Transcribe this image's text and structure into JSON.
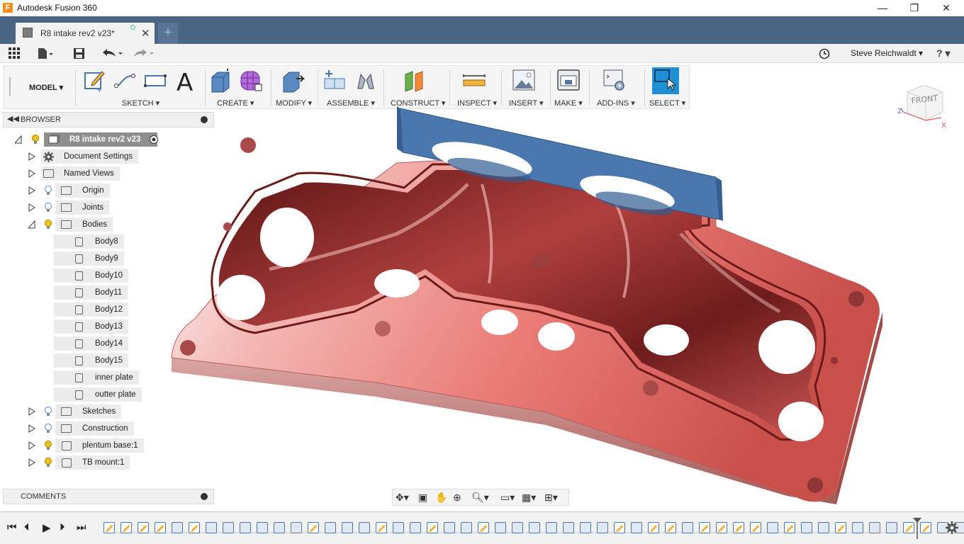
{
  "app": {
    "title": "Autodesk Fusion 360",
    "icon_letter": "F"
  },
  "window_controls": {
    "minimize": "—",
    "maximize": "❐",
    "close": "✕"
  },
  "tab": {
    "label": "R8 intake rev2 v23*",
    "close": "✕",
    "new_tab": "+"
  },
  "user": {
    "name": "Steve Reichwaldt ▾",
    "help": "? ▾"
  },
  "toolbar": {
    "workspace": "MODEL ▾",
    "groups": [
      {
        "label": "SKETCH ▾"
      },
      {
        "label": "CREATE ▾"
      },
      {
        "label": "MODIFY ▾"
      },
      {
        "label": "ASSEMBLE ▾"
      },
      {
        "label": "CONSTRUCT ▾"
      },
      {
        "label": "INSPECT ▾"
      },
      {
        "label": "INSERT ▾"
      },
      {
        "label": "MAKE ▾"
      },
      {
        "label": "ADD-INS ▾"
      },
      {
        "label": "SELECT ▾"
      }
    ],
    "sketch_text_icon": "A"
  },
  "browser": {
    "title": "BROWSER",
    "root": "R8 intake rev2 v23",
    "items": [
      {
        "label": "Document Settings"
      },
      {
        "label": "Named Views"
      },
      {
        "label": "Origin"
      },
      {
        "label": "Joints"
      },
      {
        "label": "Bodies"
      },
      {
        "label": "Body8"
      },
      {
        "label": "Body9"
      },
      {
        "label": "Body10"
      },
      {
        "label": "Body11"
      },
      {
        "label": "Body12"
      },
      {
        "label": "Body13"
      },
      {
        "label": "Body14"
      },
      {
        "label": "Body15"
      },
      {
        "label": "inner plate"
      },
      {
        "label": "outter plate"
      },
      {
        "label": "Sketches"
      },
      {
        "label": "Construction"
      },
      {
        "label": "plentum base:1"
      },
      {
        "label": "TB mount:1"
      }
    ]
  },
  "comments": {
    "title": "COMMENTS"
  },
  "viewcube": {
    "face": "FRONT",
    "axis_x": "X",
    "axis_z": "Z"
  },
  "colors": {
    "titlebar_tab": "#4b6585",
    "part_red": "#c8504f",
    "plate_blue": "#4a77ad",
    "select_blue": "#1f8fd6"
  }
}
